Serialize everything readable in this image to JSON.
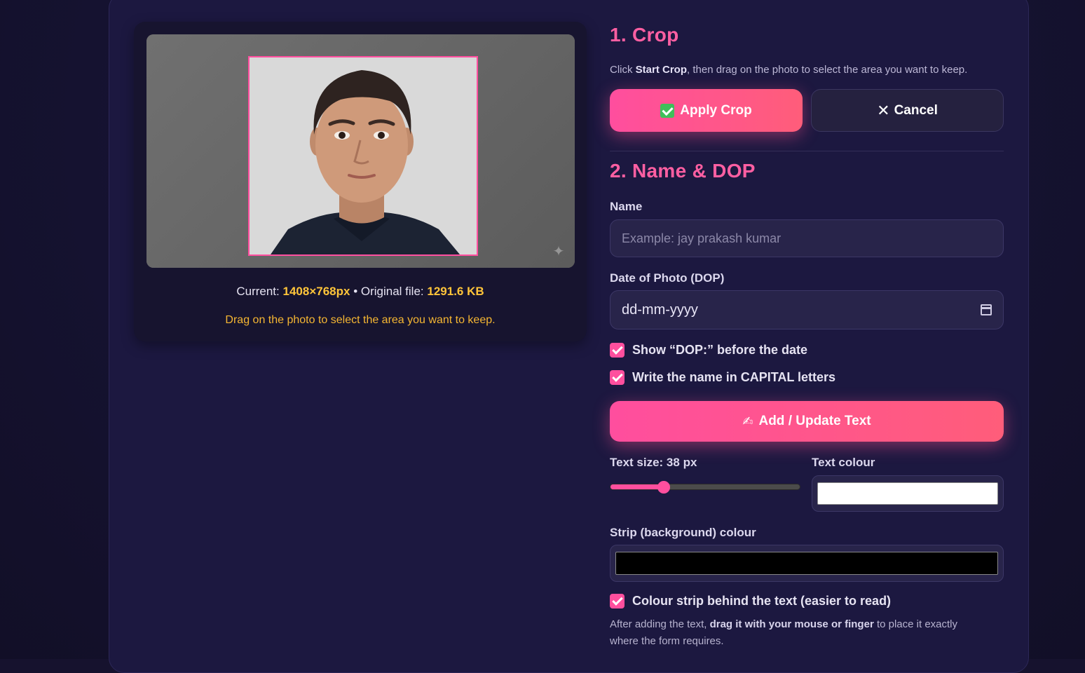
{
  "preview": {
    "current_label": "Current:",
    "current_dims": "1408×768px",
    "separator": "•",
    "original_label": "Original file:",
    "original_size": "1291.6 KB",
    "hint": "Drag on the photo to select the area you want to keep."
  },
  "crop": {
    "title": "1. Crop",
    "instruction_prefix": "Click",
    "instruction_bold": "Start Crop",
    "instruction_suffix": ", then drag on the photo to select the area you want to keep.",
    "apply_label": "Apply Crop",
    "cancel_label": "Cancel"
  },
  "name_dop": {
    "title": "2. Name & DOP",
    "name_label": "Name",
    "name_placeholder": "Example: jay prakash kumar",
    "dop_label": "Date of Photo (DOP)",
    "dop_value": "dd-mm-yyyy",
    "show_dop_label": "Show “DOP:” before the date",
    "show_dop_checked": true,
    "capital_label": "Write the name in CAPITAL letters",
    "capital_checked": true,
    "add_button_label": "Add / Update Text",
    "text_size_label": "Text size: 38 px",
    "text_size_fraction": 0.28,
    "text_colour_label": "Text colour",
    "text_colour": "#ffffff",
    "strip_label": "Strip (background) colour",
    "strip_colour": "#000000",
    "strip_checkbox_label": "Colour strip behind the text (easier to read)",
    "strip_checked": true,
    "note_prefix": "After adding the text,",
    "note_bold": "drag it with your mouse or finger",
    "note_suffix": "to place it exactly where the form requires."
  },
  "colors": {
    "accent": "#ff4f9e",
    "highlight": "#ffc53a",
    "panel": "#1c1840"
  }
}
